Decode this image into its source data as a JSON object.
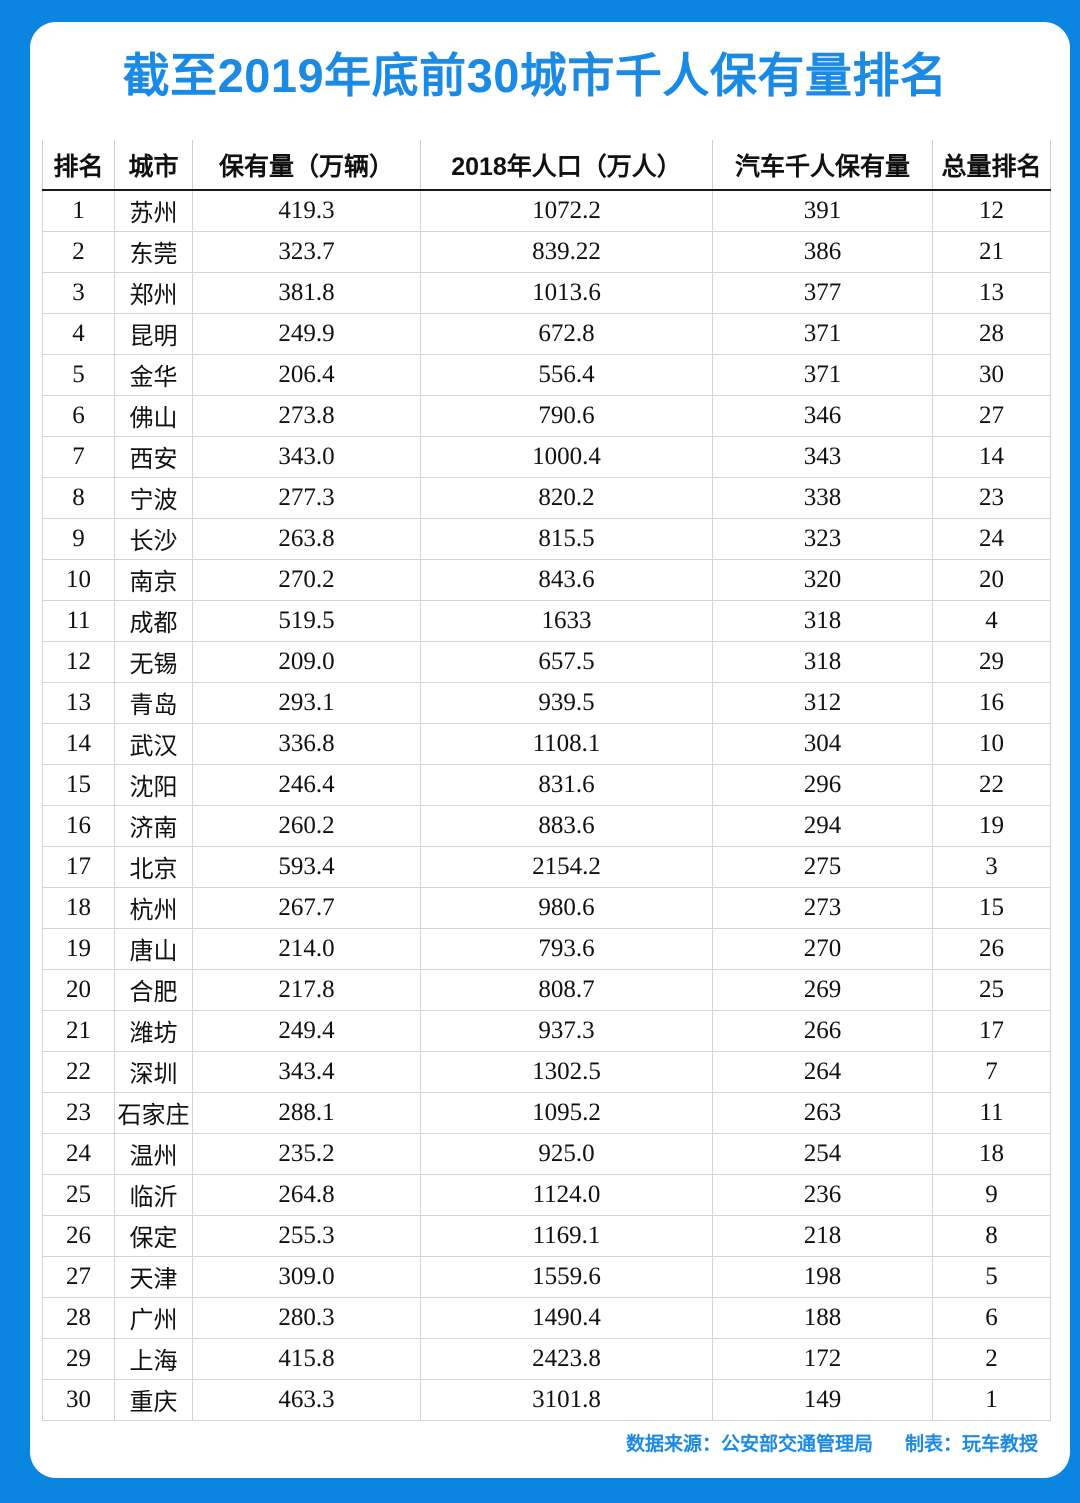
{
  "colors": {
    "brand_blue": "#0a86e0",
    "title_blue": "#1a8ae4",
    "text_black": "#111111",
    "grid_gray": "#d4d4d4"
  },
  "header": {
    "title": "截至2019年底前30城市千人保有量排名"
  },
  "footer": {
    "source": "数据来源：公安部交通管理局",
    "author": "制表：玩车教授"
  },
  "chart_data": {
    "type": "table",
    "title": "截至2019年底前30城市千人保有量排名",
    "columns": [
      "排名",
      "城市",
      "保有量（万辆）",
      "2018年人口（万人）",
      "汽车千人保有量",
      "总量排名"
    ],
    "rows": [
      [
        "1",
        "苏州",
        "419.3",
        "1072.2",
        "391",
        "12"
      ],
      [
        "2",
        "东莞",
        "323.7",
        "839.22",
        "386",
        "21"
      ],
      [
        "3",
        "郑州",
        "381.8",
        "1013.6",
        "377",
        "13"
      ],
      [
        "4",
        "昆明",
        "249.9",
        "672.8",
        "371",
        "28"
      ],
      [
        "5",
        "金华",
        "206.4",
        "556.4",
        "371",
        "30"
      ],
      [
        "6",
        "佛山",
        "273.8",
        "790.6",
        "346",
        "27"
      ],
      [
        "7",
        "西安",
        "343.0",
        "1000.4",
        "343",
        "14"
      ],
      [
        "8",
        "宁波",
        "277.3",
        "820.2",
        "338",
        "23"
      ],
      [
        "9",
        "长沙",
        "263.8",
        "815.5",
        "323",
        "24"
      ],
      [
        "10",
        "南京",
        "270.2",
        "843.6",
        "320",
        "20"
      ],
      [
        "11",
        "成都",
        "519.5",
        "1633",
        "318",
        "4"
      ],
      [
        "12",
        "无锡",
        "209.0",
        "657.5",
        "318",
        "29"
      ],
      [
        "13",
        "青岛",
        "293.1",
        "939.5",
        "312",
        "16"
      ],
      [
        "14",
        "武汉",
        "336.8",
        "1108.1",
        "304",
        "10"
      ],
      [
        "15",
        "沈阳",
        "246.4",
        "831.6",
        "296",
        "22"
      ],
      [
        "16",
        "济南",
        "260.2",
        "883.6",
        "294",
        "19"
      ],
      [
        "17",
        "北京",
        "593.4",
        "2154.2",
        "275",
        "3"
      ],
      [
        "18",
        "杭州",
        "267.7",
        "980.6",
        "273",
        "15"
      ],
      [
        "19",
        "唐山",
        "214.0",
        "793.6",
        "270",
        "26"
      ],
      [
        "20",
        "合肥",
        "217.8",
        "808.7",
        "269",
        "25"
      ],
      [
        "21",
        "潍坊",
        "249.4",
        "937.3",
        "266",
        "17"
      ],
      [
        "22",
        "深圳",
        "343.4",
        "1302.5",
        "264",
        "7"
      ],
      [
        "23",
        "石家庄",
        "288.1",
        "1095.2",
        "263",
        "11"
      ],
      [
        "24",
        "温州",
        "235.2",
        "925.0",
        "254",
        "18"
      ],
      [
        "25",
        "临沂",
        "264.8",
        "1124.0",
        "236",
        "9"
      ],
      [
        "26",
        "保定",
        "255.3",
        "1169.1",
        "218",
        "8"
      ],
      [
        "27",
        "天津",
        "309.0",
        "1559.6",
        "198",
        "5"
      ],
      [
        "28",
        "广州",
        "280.3",
        "1490.4",
        "188",
        "6"
      ],
      [
        "29",
        "上海",
        "415.8",
        "2423.8",
        "172",
        "2"
      ],
      [
        "30",
        "重庆",
        "463.3",
        "3101.8",
        "149",
        "1"
      ]
    ]
  }
}
